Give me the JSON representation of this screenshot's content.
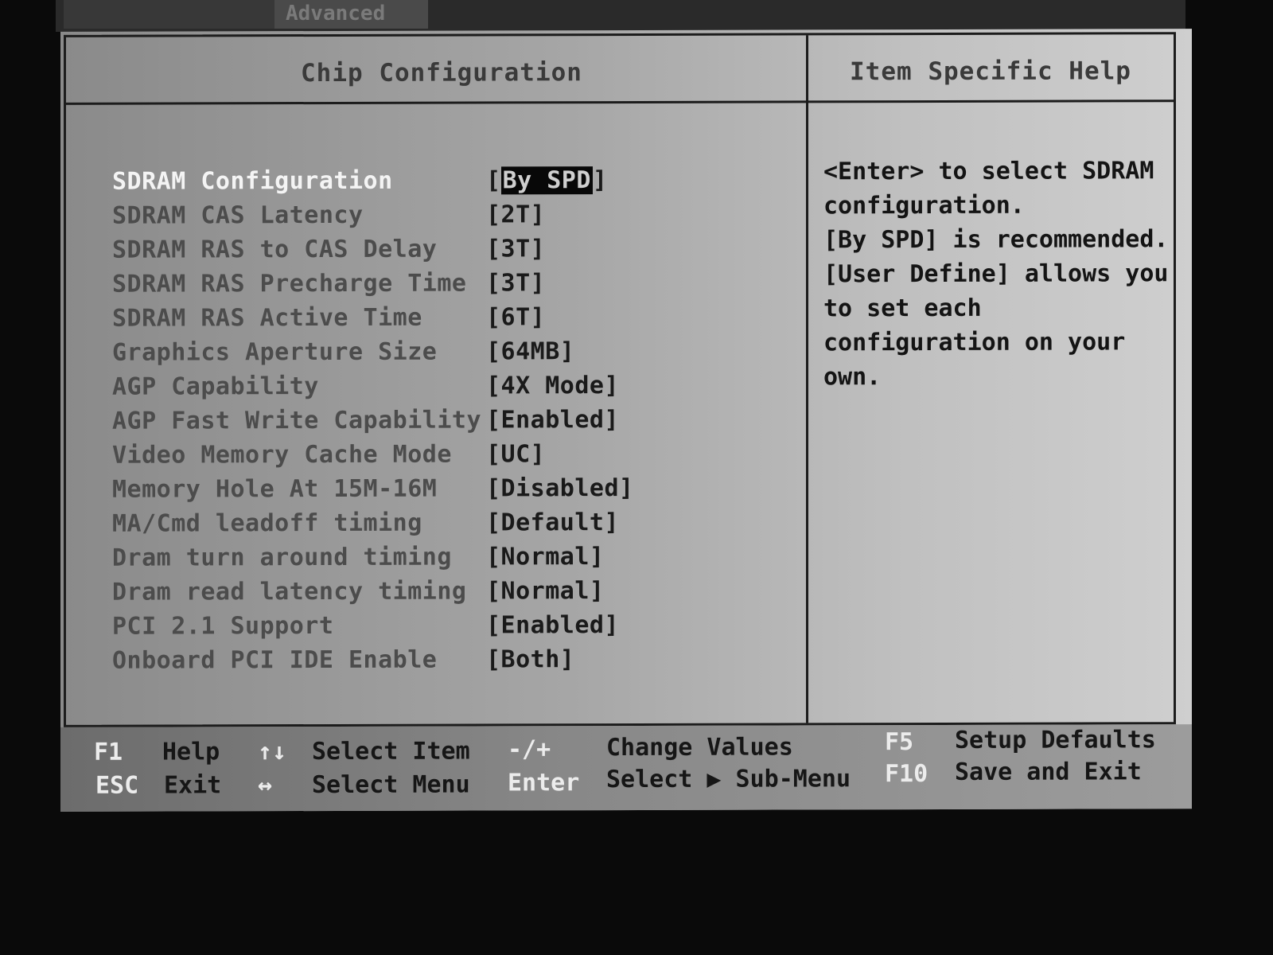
{
  "tabs": [
    {
      "label": ""
    },
    {
      "label": "Advanced"
    }
  ],
  "panel": {
    "title": "Chip Configuration",
    "help_title": "Item Specific Help"
  },
  "settings": [
    {
      "label": "SDRAM Configuration",
      "value_open": "[",
      "value": "By SPD",
      "value_close": "]"
    },
    {
      "label": "SDRAM CAS Latency",
      "value": "[2T]"
    },
    {
      "label": "SDRAM RAS to CAS Delay",
      "value": "[3T]"
    },
    {
      "label": "SDRAM RAS Precharge Time",
      "value": "[3T]"
    },
    {
      "label": "SDRAM RAS Active Time",
      "value": "[6T]"
    },
    {
      "label": "Graphics Aperture Size",
      "value": "[64MB]"
    },
    {
      "label": "AGP Capability",
      "value": "[4X Mode]"
    },
    {
      "label": "AGP Fast Write Capability",
      "value": "[Enabled]"
    },
    {
      "label": "Video Memory Cache Mode",
      "value": "[UC]"
    },
    {
      "label": "Memory Hole At 15M-16M",
      "value": "[Disabled]"
    },
    {
      "label": "MA/Cmd leadoff timing",
      "value": "[Default]"
    },
    {
      "label": "Dram turn around timing",
      "value": "[Normal]"
    },
    {
      "label": "Dram read latency timing",
      "value": "[Normal]"
    },
    {
      "label": "PCI 2.1 Support",
      "value": "[Enabled]"
    },
    {
      "label": "Onboard PCI IDE Enable",
      "value": "[Both]"
    }
  ],
  "help_lines": [
    "<Enter> to select SDRAM",
    "configuration.",
    "[By SPD] is recommended.",
    "[User Define] allows you",
    "to set each",
    "configuration on your",
    "own."
  ],
  "footer": {
    "f1_key": "F1",
    "f1_desc": "Help",
    "updown_key": "↑↓",
    "updown_desc": "Select Item",
    "minusplus_key": "-/+",
    "minusplus_desc": "Change Values",
    "f5_key": "F5",
    "f5_desc": "Setup Defaults",
    "esc_key": "ESC",
    "esc_desc": "Exit",
    "leftright_key": "↔",
    "leftright_desc": "Select Menu",
    "enter_key": "Enter",
    "enter_desc": "Select ▶ Sub-Menu",
    "f10_key": "F10",
    "f10_desc": "Save and Exit"
  }
}
